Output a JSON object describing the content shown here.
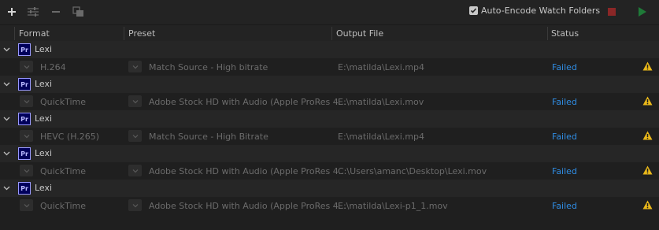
{
  "toolbar": {
    "add_icon": "plus-icon",
    "settings_icon": "sliders-icon",
    "remove_icon": "minus-icon",
    "duplicate_icon": "duplicate-icon",
    "watch_folders_label": "Auto-Encode Watch Folders",
    "watch_folders_checked": true,
    "stop_icon": "stop-icon",
    "start_icon": "play-icon"
  },
  "columns": [
    "Format",
    "Preset",
    "Output File",
    "Status"
  ],
  "queue": [
    {
      "name": "Lexi",
      "format": "H.264",
      "preset": "Match Source - High bitrate",
      "output": "E:\\matilda\\Lexi.mp4",
      "status": "Failed"
    },
    {
      "name": "Lexi",
      "format": "QuickTime",
      "preset": "Adobe Stock HD with Audio (Apple ProRes 4...",
      "output": "E:\\matilda\\Lexi.mov",
      "status": "Failed"
    },
    {
      "name": "Lexi",
      "format": "HEVC (H.265)",
      "preset": "Match Source - High Bitrate",
      "output": "E:\\matilda\\Lexi.mp4",
      "status": "Failed"
    },
    {
      "name": "Lexi",
      "format": "QuickTime",
      "preset": "Adobe Stock HD with Audio (Apple ProRes 4...",
      "output": "C:\\Users\\amanc\\Desktop\\Lexi.mov",
      "status": "Failed"
    },
    {
      "name": "Lexi",
      "format": "QuickTime",
      "preset": "Adobe Stock HD with Audio (Apple ProRes 4...",
      "output": "E:\\matilda\\Lexi-p1_1.mov",
      "status": "Failed"
    }
  ],
  "badge_text": "Pr",
  "colors": {
    "status_failed": "#2f8ce3",
    "warning": "#e8b71a",
    "stop": "#8b2727",
    "play": "#1f7a38",
    "premiere_badge": "#00005b"
  }
}
